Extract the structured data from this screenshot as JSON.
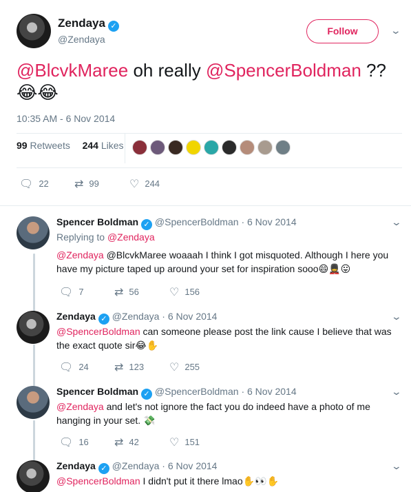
{
  "main_tweet": {
    "name": "Zendaya",
    "handle": "@Zendaya",
    "follow_label": "Follow",
    "text_mention_1": "@BlcvkMaree",
    "text_body": " oh really ",
    "text_mention_2": "@SpencerBoldman",
    "text_tail": " ??",
    "emojis": "😂😂",
    "timestamp": "10:35 AM - 6 Nov 2014",
    "retweets_count": "99",
    "retweets_label": "Retweets",
    "likes_count": "244",
    "likes_label": "Likes",
    "actions": {
      "replies": "22",
      "retweets": "99",
      "likes": "244"
    }
  },
  "icons": {
    "reply": "reply-icon",
    "retweet": "retweet-icon",
    "like": "heart-icon",
    "verified": "verified-badge-icon",
    "more": "chevron-down-icon"
  },
  "colors": {
    "accent": "#e0245e",
    "verified": "#1da1f2",
    "muted": "#657786"
  },
  "replies": [
    {
      "name": "Spencer Boldman",
      "handle": "@SpencerBoldman",
      "date": "6 Nov 2014",
      "replying_prefix": "Replying to",
      "replying_to": "@Zendaya",
      "mention": "@Zendaya",
      "text": " @BlcvkMaree woaaah I think I got misquoted. Although I here you have my picture taped up around your set for inspiration sooo",
      "emojis": "😄💂😛",
      "replies": "7",
      "retweets": "56",
      "likes": "156"
    },
    {
      "name": "Zendaya",
      "handle": "@Zendaya",
      "date": "6 Nov 2014",
      "mention": "@SpencerBoldman",
      "text": " can someone please post the link cause I believe that was the exact quote sir",
      "emojis": "😂✋",
      "replies": "24",
      "retweets": "123",
      "likes": "255"
    },
    {
      "name": "Spencer Boldman",
      "handle": "@SpencerBoldman",
      "date": "6 Nov 2014",
      "mention": "@Zendaya",
      "text": " and let's not ignore the fact you do indeed have a photo of me hanging in your set.",
      "emojis": "💸",
      "replies": "16",
      "retweets": "42",
      "likes": "151"
    },
    {
      "name": "Zendaya",
      "handle": "@Zendaya",
      "date": "6 Nov 2014",
      "mention": "@SpencerBoldman",
      "text": " I didn't put it there lmao",
      "emojis": "✋👀✋"
    }
  ]
}
